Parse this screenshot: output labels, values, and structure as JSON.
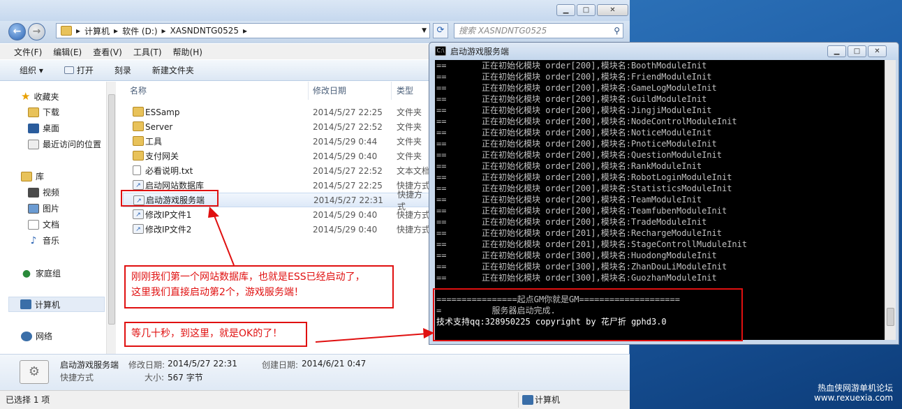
{
  "explorer": {
    "address": [
      "计算机",
      "软件 (D:)",
      "XASNDNTG0525"
    ],
    "search_placeholder": "搜索 XASNDNTG0525",
    "menu": [
      "文件(F)",
      "编辑(E)",
      "查看(V)",
      "工具(T)",
      "帮助(H)"
    ],
    "toolbar": {
      "organize": "组织 ▾",
      "open": "打开",
      "burn": "刻录",
      "new_folder": "新建文件夹"
    },
    "nav": {
      "favorites": "收藏夹",
      "downloads": "下载",
      "desktop": "桌面",
      "recent": "最近访问的位置",
      "libraries": "库",
      "videos": "视频",
      "pictures": "图片",
      "documents": "文档",
      "music": "音乐",
      "homegroup": "家庭组",
      "computer": "计算机",
      "network": "网络"
    },
    "columns": {
      "name": "名称",
      "date": "修改日期",
      "type": "类型"
    },
    "files": [
      {
        "name": "ESSamp",
        "date": "2014/5/27 22:25",
        "type": "文件夹"
      },
      {
        "name": "Server",
        "date": "2014/5/27 22:52",
        "type": "文件夹"
      },
      {
        "name": "工具",
        "date": "2014/5/29 0:44",
        "type": "文件夹"
      },
      {
        "name": "支付网关",
        "date": "2014/5/29 0:40",
        "type": "文件夹"
      },
      {
        "name": "必看说明.txt",
        "date": "2014/5/27 22:52",
        "type": "文本文档"
      },
      {
        "name": "启动网站数据库",
        "date": "2014/5/27 22:25",
        "type": "快捷方式"
      },
      {
        "name": "启动游戏服务端",
        "date": "2014/5/27 22:31",
        "type": "快捷方式"
      },
      {
        "name": "修改IP文件1",
        "date": "2014/5/29 0:40",
        "type": "快捷方式"
      },
      {
        "name": "修改IP文件2",
        "date": "2014/5/29 0:40",
        "type": "快捷方式"
      }
    ],
    "details": {
      "name": "启动游戏服务端",
      "kind": "快捷方式",
      "modified_label": "修改日期:",
      "modified": "2014/5/27 22:31",
      "created_label": "创建日期:",
      "created": "2014/6/21 0:47",
      "size_label": "大小:",
      "size": "567 字节"
    },
    "status": {
      "selected": "已选择 1 项",
      "location": "计算机"
    }
  },
  "console": {
    "title": "启动游戏服务端",
    "lines": [
      "==       正在初始化模块 order[200],模块名:BoothModuleInit",
      "==       正在初始化模块 order[200],模块名:FriendModuleInit",
      "==       正在初始化模块 order[200],模块名:GameLogModuleInit",
      "==       正在初始化模块 order[200],模块名:GuildModuleInit",
      "==       正在初始化模块 order[200],模块名:JingjiModuleInit",
      "==       正在初始化模块 order[200],模块名:NodeControlModuleInit",
      "==       正在初始化模块 order[200],模块名:NoticeModuleInit",
      "==       正在初始化模块 order[200],模块名:PnoticeModuleInit",
      "==       正在初始化模块 order[200],模块名:QuestionModuleInit",
      "==       正在初始化模块 order[200],模块名:RankModuleInit",
      "==       正在初始化模块 order[200],模块名:RobotLoginModuleInit",
      "==       正在初始化模块 order[200],模块名:StatisticsModuleInit",
      "==       正在初始化模块 order[200],模块名:TeamModuleInit",
      "==       正在初始化模块 order[200],模块名:TeamfubenModuleInit",
      "==       正在初始化模块 order[200],模块名:TradeModuleInit",
      "==       正在初始化模块 order[201],模块名:RechargeModuleInit",
      "==       正在初始化模块 order[201],模块名:StageControllMuduleInit",
      "==       正在初始化模块 order[300],模块名:HuodongModuleInit",
      "==       正在初始化模块 order[300],模块名:ZhanDouLiModuleInit",
      "==       正在初始化模块 order[300],模块名:GuozhanModuleInit"
    ],
    "banner": "================起点GM你就是GM====================",
    "ready": "=          服务器启动完成.",
    "copyright": "技术支持qq:328950225 copyright by 花尸折 gphd3.0"
  },
  "annotations": {
    "note1_line1": "刚刚我们第一个网站数据库，也就是ESS已经启动了，",
    "note1_line2": "这里我们直接启动第2个，游戏服务端！",
    "note2": "等几十秒，到这里，就是OK的了！"
  },
  "watermark": {
    "line1": "热血侠网游单机论坛",
    "line2": "www.rexuexia.com"
  }
}
